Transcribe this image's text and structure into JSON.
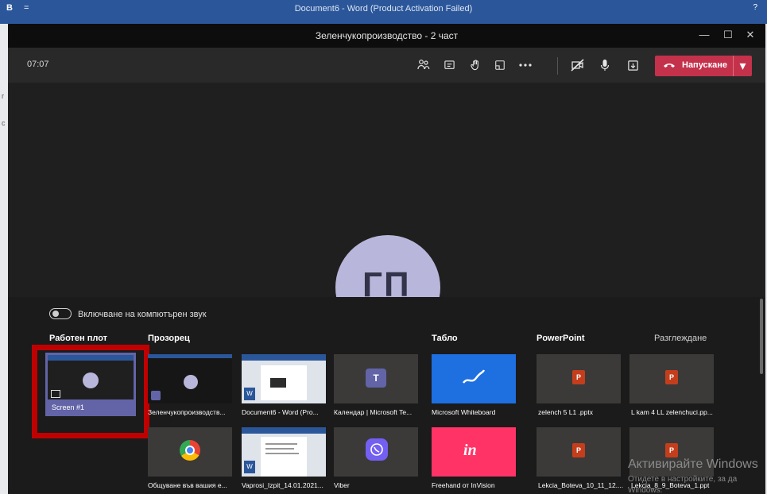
{
  "word": {
    "logo": "B",
    "qat": "=",
    "title": "Document6 - Word (Product Activation Failed)",
    "controls": "?",
    "side_chars": [
      "г",
      "с"
    ]
  },
  "window": {
    "title": "Зеленчукопроизводство - 2 част",
    "minimize": "—",
    "maximize": "☐",
    "close": "✕"
  },
  "toolbar": {
    "timer": "07:07",
    "leave_label": "Напускане",
    "leave_icon": "phone-hangup-icon",
    "dropdown": "▾"
  },
  "stage": {
    "avatar_initials": "ГП"
  },
  "tray": {
    "computer_audio_label": "Включване на компютърен звук",
    "sections": {
      "desktop": "Работен плот",
      "window": "Прозорец",
      "board": "Табло",
      "powerpoint": "PowerPoint",
      "browse": "Разглеждане"
    },
    "desktop_screen_label": "Screen #1",
    "windows_row1": [
      "Зеленчукопроизводств...",
      "Document6 - Word (Pro...",
      "Календар | Microsoft Te..."
    ],
    "windows_row2": [
      "Общуване във вашия е...",
      "Vaprosi_Izpit_14.01.2021...",
      "Viber"
    ],
    "boards": [
      "Microsoft Whiteboard",
      "Freehand от InVision"
    ],
    "ppt_row1": [
      "zelench 5 L1 .pptx",
      "L kam 4 LL zelenchuci.pp..."
    ],
    "ppt_row2": [
      "Lekcia_Boteva_10_11_12....",
      "Lekcia_8_9_Boteva_1.ppt"
    ],
    "ppt_icon_letter": "P",
    "invision_letters": "in"
  },
  "watermark": {
    "line1": "Активирайте Windows",
    "line2": "Отидете в настройките, за да",
    "line3": "Windows."
  },
  "colors": {
    "leave": "#c4314b",
    "teams_purple": "#6264a7",
    "selection_red": "#c00000",
    "whiteboard_blue": "#1e6fe0",
    "invision_pink": "#ff3366",
    "powerpoint": "#c43e1c"
  }
}
